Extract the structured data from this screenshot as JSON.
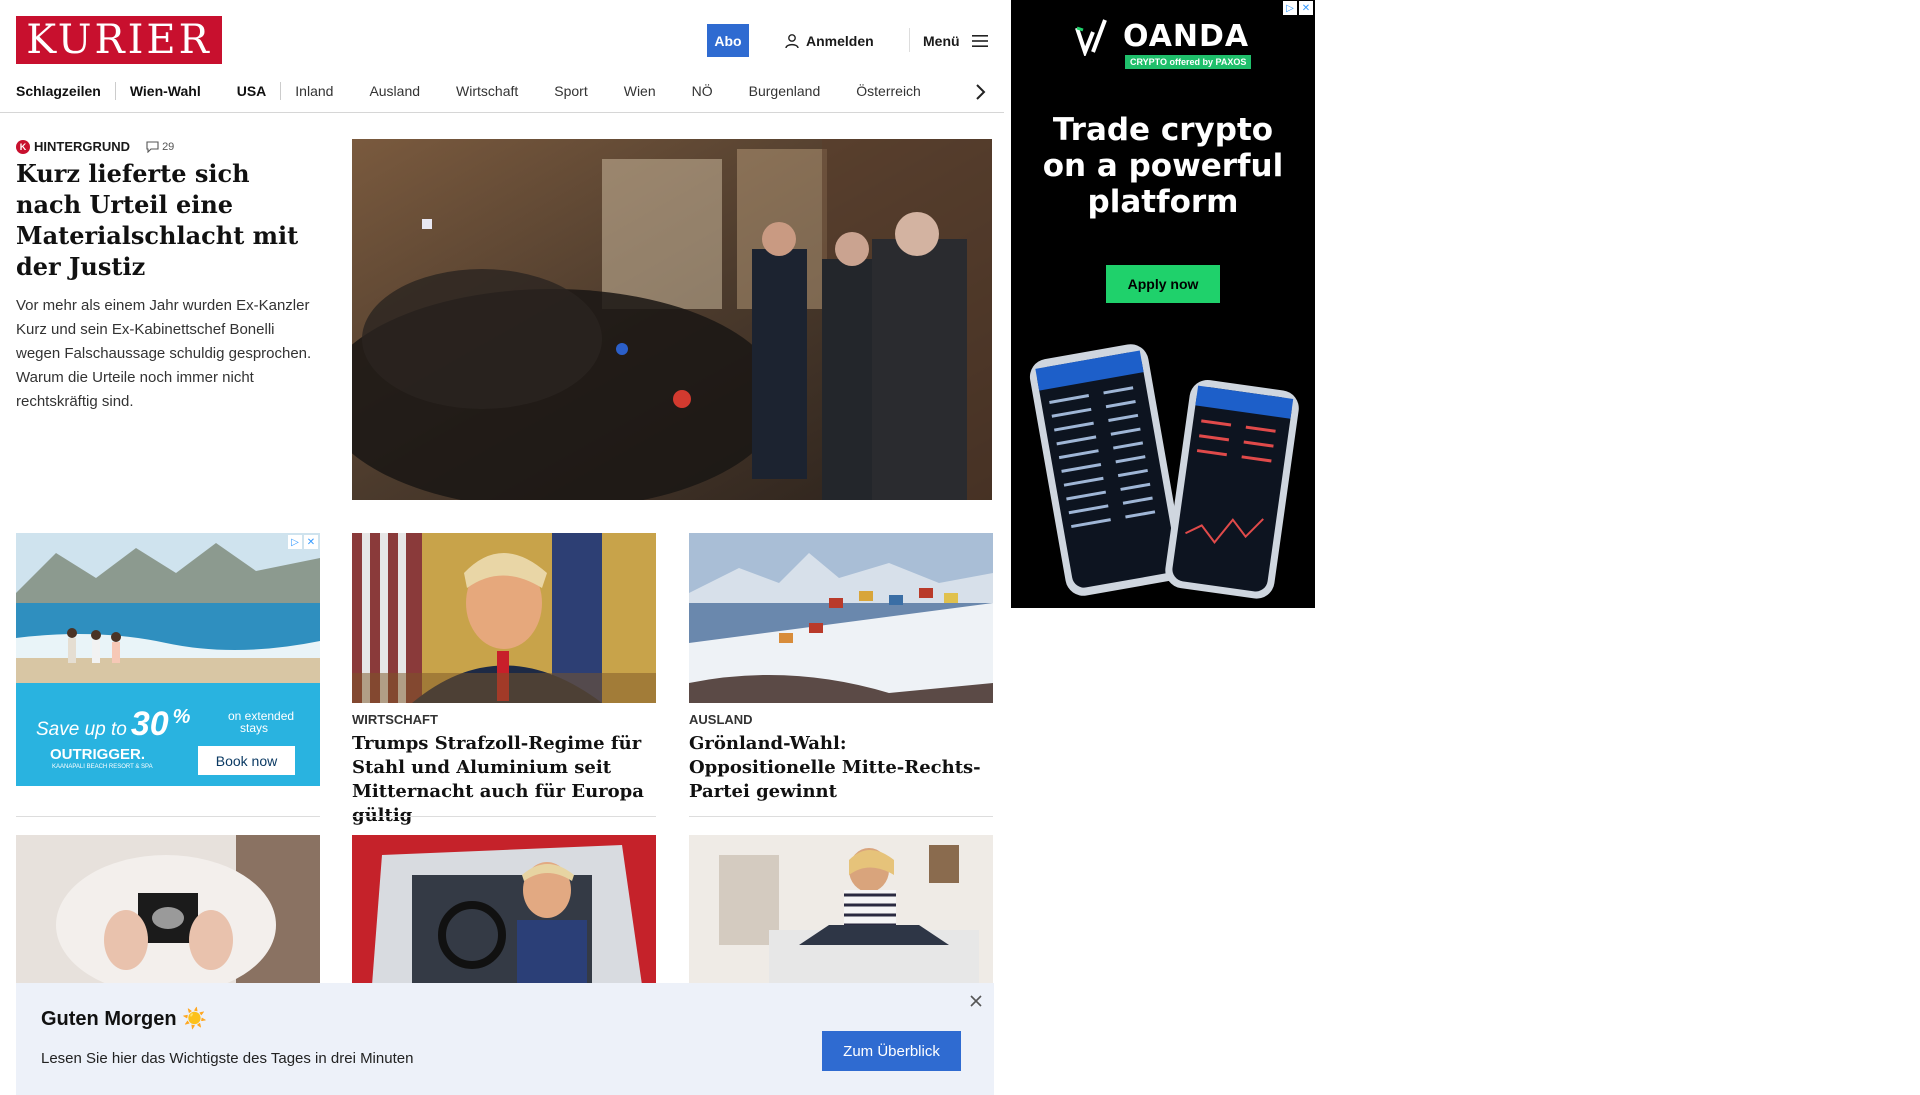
{
  "header": {
    "logo": "KURIER",
    "abo": "Abo",
    "login": "Anmelden",
    "menu": "Menü"
  },
  "nav": {
    "items": [
      "Schlagzeilen",
      "Wien-Wahl",
      "USA",
      "Inland",
      "Ausland",
      "Wirtschaft",
      "Sport",
      "Wien",
      "NÖ",
      "Burgenland",
      "Österreich"
    ]
  },
  "hero": {
    "rubric": "HINTERGRUND",
    "comments": "29",
    "title": "Kurz lieferte sich nach Urteil eine Materialschlacht mit der Justiz",
    "teaser": "Vor mehr als einem Jahr wurden Ex-Kanzler Kurz und sein Ex-Kabinettschef Bonelli wegen Falschaussage schuldig gesprochen. Warum die Urteile noch immer nicht rechtskräftig sind."
  },
  "ad_left": {
    "headline_pre": "Save up to",
    "percent": "30",
    "pct_sign": "%",
    "headline_post1": "on extended",
    "headline_post2": "stays",
    "brand": "OUTRIGGER.",
    "brand_sub": "KAANAPALI BEACH RESORT & SPA",
    "cta": "Book now"
  },
  "cards": [
    {
      "rubric": "WIRTSCHAFT",
      "title": "Trumps Strafzoll-Regime für Stahl und Aluminium seit Mitternacht auch für Europa gültig"
    },
    {
      "rubric": "AUSLAND",
      "title": "Grönland-Wahl: Oppositionelle Mitte-Rechts-Partei gewinnt"
    }
  ],
  "ad_right": {
    "brand": "OANDA",
    "tag": "CRYPTO offered by PAXOS",
    "headline": [
      "Trade crypto",
      "on a powerful",
      "platform"
    ],
    "cta": "Apply now"
  },
  "banner": {
    "title": "Guten Morgen ☀️",
    "subtitle": "Lesen Sie hier das Wichtigste des Tages in drei Minuten",
    "cta": "Zum Überblick"
  },
  "colors": {
    "brand": "#c8102e",
    "accent": "#2f6bd1",
    "banner_bg": "#edf1f9",
    "oanda_green": "#1fd16b"
  }
}
